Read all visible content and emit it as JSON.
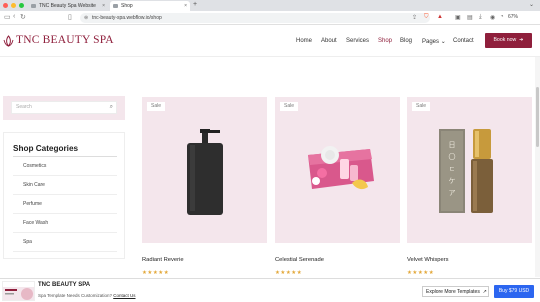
{
  "browser": {
    "tabs": [
      {
        "title": "TNC Beauty Spa Website Page ..."
      },
      {
        "title": "Shop"
      }
    ],
    "url": "tnc-beauty-spa.webflow.io/shop",
    "battery": "67%"
  },
  "header": {
    "logo_text": "TNC BEAUTY SPA",
    "nav": [
      "Home",
      "About",
      "Services",
      "Shop",
      "Blog",
      "Pages",
      "Contact"
    ],
    "active_nav": "Shop",
    "book_label": "Book now",
    "book_icon": "arrow-right"
  },
  "sidebar": {
    "search_placeholder": "Search",
    "categories_title": "Shop Categories",
    "categories": [
      "Cosmetics",
      "Skin Care",
      "Perfume",
      "Face Wash",
      "Spa"
    ]
  },
  "products": [
    {
      "badge": "Sale",
      "name": "Radiant Reverie",
      "rating": 5
    },
    {
      "badge": "Sale",
      "name": "Celestial Serenade",
      "rating": 5
    },
    {
      "badge": "Sale",
      "name": "Velvet Whispers",
      "rating": 5
    }
  ],
  "template_bar": {
    "title": "TNC BEAUTY SPA",
    "subtitle": "Spa Template Needs Customization?",
    "contact_link": "Contact Us",
    "explore_label": "Explore More Templates",
    "buy_label": "Buy $79 USD"
  },
  "colors": {
    "brand": "#8f1f3c",
    "card_bg": "#f4e6ec",
    "buy_button": "#2c66f0",
    "star": "#e3a83a"
  }
}
